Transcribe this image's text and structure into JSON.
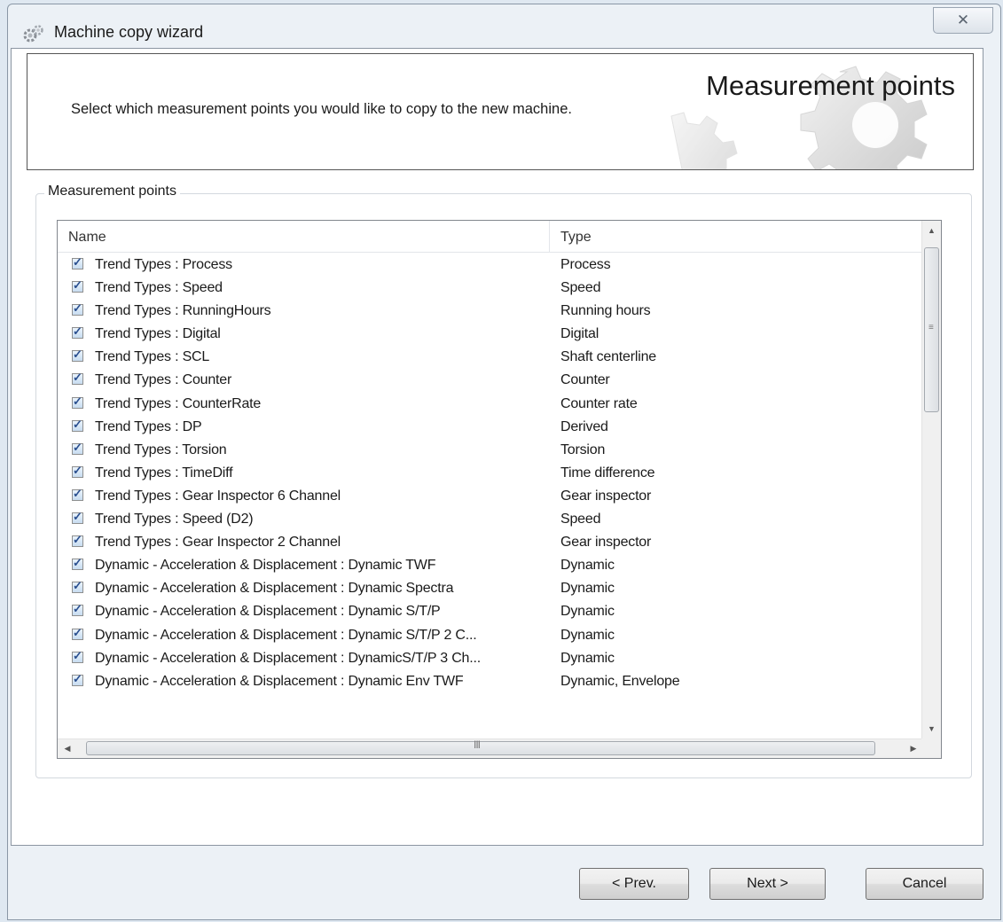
{
  "window": {
    "title": "Machine copy wizard",
    "close_glyph": "✕",
    "icon": "gears-icon"
  },
  "banner": {
    "heading": "Measurement points",
    "description": "Select which measurement points you would like to copy to the new machine."
  },
  "group": {
    "label": "Measurement points"
  },
  "table": {
    "columns": [
      "Name",
      "Type"
    ],
    "rows": [
      {
        "checked": true,
        "name": "Trend Types : Process",
        "type": "Process"
      },
      {
        "checked": true,
        "name": "Trend Types : Speed",
        "type": "Speed"
      },
      {
        "checked": true,
        "name": "Trend Types : RunningHours",
        "type": "Running hours"
      },
      {
        "checked": true,
        "name": "Trend Types : Digital",
        "type": "Digital"
      },
      {
        "checked": true,
        "name": "Trend Types : SCL",
        "type": "Shaft centerline"
      },
      {
        "checked": true,
        "name": "Trend Types : Counter",
        "type": "Counter"
      },
      {
        "checked": true,
        "name": "Trend Types : CounterRate",
        "type": "Counter rate"
      },
      {
        "checked": true,
        "name": "Trend Types : DP",
        "type": "Derived"
      },
      {
        "checked": true,
        "name": "Trend Types : Torsion",
        "type": "Torsion"
      },
      {
        "checked": true,
        "name": "Trend Types : TimeDiff",
        "type": "Time difference"
      },
      {
        "checked": true,
        "name": "Trend Types : Gear Inspector 6 Channel",
        "type": "Gear inspector"
      },
      {
        "checked": true,
        "name": "Trend Types : Speed (D2)",
        "type": "Speed"
      },
      {
        "checked": true,
        "name": "Trend Types : Gear Inspector 2 Channel",
        "type": "Gear inspector"
      },
      {
        "checked": true,
        "name": "Dynamic - Acceleration & Displacement : Dynamic TWF",
        "type": "Dynamic"
      },
      {
        "checked": true,
        "name": "Dynamic - Acceleration & Displacement : Dynamic Spectra",
        "type": "Dynamic"
      },
      {
        "checked": true,
        "name": "Dynamic - Acceleration & Displacement : Dynamic S/T/P",
        "type": "Dynamic"
      },
      {
        "checked": true,
        "name": "Dynamic - Acceleration & Displacement : Dynamic S/T/P 2 C...",
        "type": "Dynamic"
      },
      {
        "checked": true,
        "name": "Dynamic - Acceleration & Displacement : DynamicS/T/P 3 Ch...",
        "type": "Dynamic"
      },
      {
        "checked": true,
        "name": "Dynamic - Acceleration & Displacement : Dynamic Env TWF",
        "type": "Dynamic, Envelope"
      }
    ]
  },
  "scrollbars": {
    "vertical_grip": "≡",
    "horizontal_grip": "III",
    "up_glyph": "▲",
    "down_glyph": "▼",
    "left_glyph": "◀",
    "right_glyph": "▶"
  },
  "buttons": {
    "prev": "< Prev.",
    "next": "Next >",
    "cancel": "Cancel"
  }
}
